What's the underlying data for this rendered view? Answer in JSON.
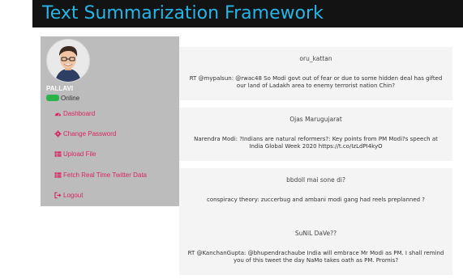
{
  "header": {
    "title": "Text Summarization Framework"
  },
  "sidebar": {
    "user_name": "PALLAVI",
    "status": "Online",
    "nav": [
      {
        "label": "Dashboard",
        "icon": "dashboard-icon"
      },
      {
        "label": "Change Password",
        "icon": "gear-icon"
      },
      {
        "label": "Upload File",
        "icon": "table-icon"
      },
      {
        "label": "Fetch Real Time Twitter Data",
        "icon": "table-icon"
      },
      {
        "label": "Logout",
        "icon": "logout-icon"
      }
    ]
  },
  "tweets": [
    {
      "user": "oru_kattan",
      "text": "RT @mypalsun: @rwac48 So Modi govt out of fear or due to some hidden deal has gifted our land of Ladakh area to enemy terrorist nation Chin?"
    },
    {
      "user": "Ojas Marugujarat",
      "text": "Narendra Modi: ?Indians are natural reformers?: Key points from PM Modi?s speech at India Global Week 2020 https://t.co/IzLdPI4kyO"
    },
    {
      "user": "bbdoll mai sone di?",
      "text": "conspiracy theory: zuccerbug and ambani modi gang had reels preplanned ?"
    },
    {
      "user": "SuNiL DaVe??",
      "text": "RT @KanchanGupta: @bhupendrachaube India will embrace Mr Modi as PM. I shall remind you of this tweet the day NaMo takes oath as PM. Promis?"
    }
  ],
  "colors": {
    "title": "#26b5e6",
    "header_bg": "#131313",
    "sidebar_bg": "#bcbcbc",
    "nav_link": "#d9265f",
    "online": "#29b34a"
  }
}
